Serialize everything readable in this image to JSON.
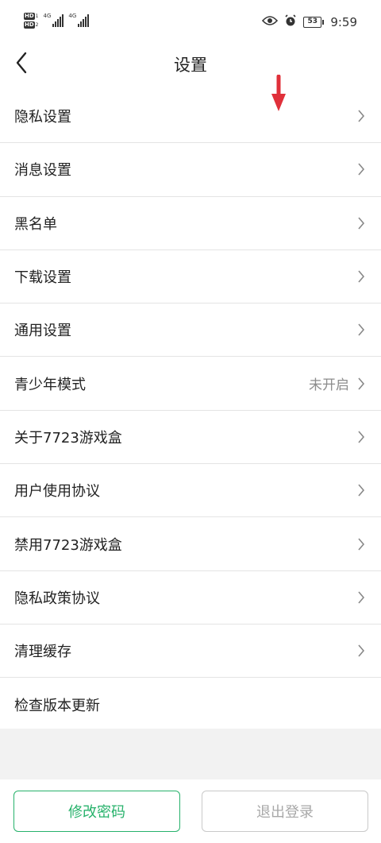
{
  "status_bar": {
    "hd_label": "HD",
    "hd_sub": "1",
    "hd2_sub": "2",
    "network_1": "4G",
    "network_2": "4G",
    "battery": "53",
    "time": "9:59"
  },
  "header": {
    "title": "设置"
  },
  "settings": [
    {
      "label": "隐私设置"
    },
    {
      "label": "消息设置"
    },
    {
      "label": "黑名单"
    },
    {
      "label": "下载设置"
    },
    {
      "label": "通用设置"
    },
    {
      "label": "青少年模式",
      "value": "未开启"
    },
    {
      "label": "关于7723游戏盒"
    },
    {
      "label": "用户使用协议"
    },
    {
      "label": "禁用7723游戏盒"
    },
    {
      "label": "隐私政策协议"
    },
    {
      "label": "清理缓存"
    },
    {
      "label": "检查版本更新"
    }
  ],
  "footer": {
    "change_password": "修改密码",
    "logout": "退出登录"
  },
  "colors": {
    "accent_green": "#27b26b",
    "annotation_arrow": "#e0303a",
    "disabled_gray": "#a8a8a8"
  },
  "icons": {
    "back": "chevron-left-icon",
    "row": "chevron-right-icon",
    "annotation": "red-down-arrow"
  }
}
